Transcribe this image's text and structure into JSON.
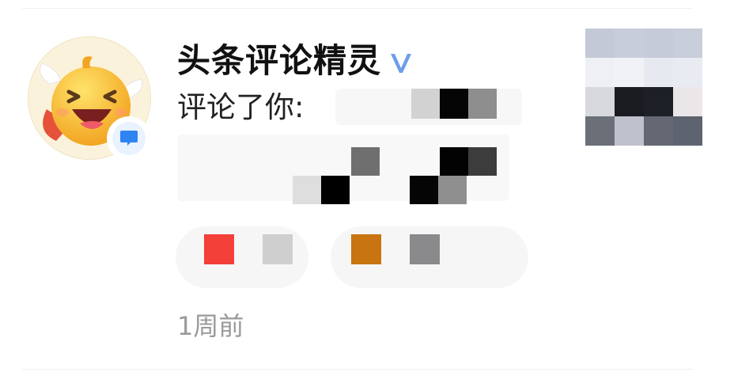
{
  "notification": {
    "sender_name": "头条评论精灵",
    "verified_mark": "V",
    "action_text": "评论了你:",
    "time_ago": "1周前"
  },
  "icons": {
    "avatar": "smiling-cartoon-avatar",
    "badge": "comment-bubble-icon",
    "verified": "verified-v-icon"
  },
  "colors": {
    "verified": "#6e9eea",
    "badge_bubble": "#2f84f2",
    "time_text": "#9a9a9a"
  }
}
